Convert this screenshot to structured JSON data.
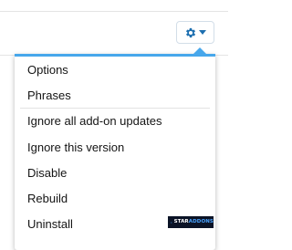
{
  "menu": {
    "items": [
      {
        "label": "Options"
      },
      {
        "label": "Phrases"
      },
      {
        "label": "Ignore all add-on updates"
      },
      {
        "label": "Ignore this version"
      },
      {
        "label": "Disable"
      },
      {
        "label": "Rebuild"
      },
      {
        "label": "Uninstall"
      }
    ]
  },
  "controls": {
    "gear_icon": "gear-icon",
    "caret_icon": "caret-down-icon"
  },
  "watermark": {
    "brand_part1": "STAR",
    "brand_part2": "ADDONS"
  },
  "colors": {
    "accent": "#47a7eb",
    "icon": "#1d6fb0",
    "text": "#141414"
  }
}
